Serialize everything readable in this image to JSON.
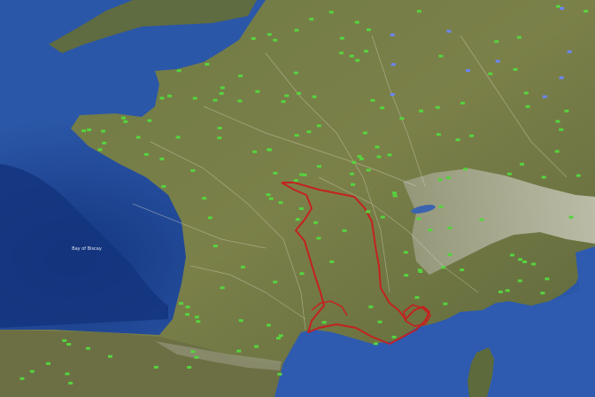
{
  "map": {
    "type": "satellite",
    "colors": {
      "sea_deep": "#14357e",
      "sea": "#2b57a8",
      "sea_shallow": "#4c7cc4",
      "land": "#6f7a45",
      "land_dark": "#56603a",
      "mountains": "#c9cbbf",
      "route": "#c81e1e",
      "marker_green": "#56d43e",
      "marker_blue": "#6a86ff",
      "roads": "#e6e1cf"
    },
    "labels": {
      "bay": "Bay of Biscay"
    },
    "icons": {
      "marker": "road-shield-icon"
    }
  }
}
